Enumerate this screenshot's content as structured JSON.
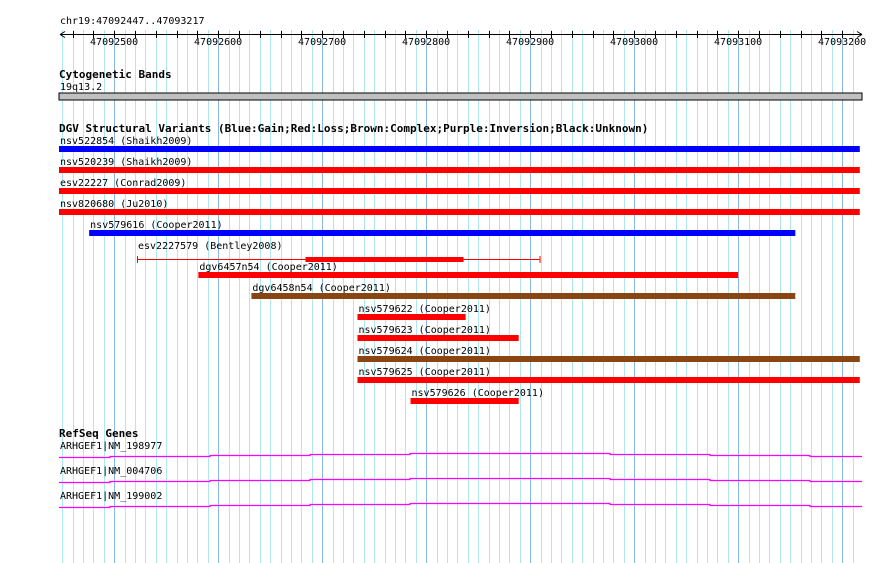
{
  "view": {
    "chrom": "chr19",
    "start": 47092447,
    "end": 47093217,
    "region_label": "chr19:47092447..47093217"
  },
  "ruler": {
    "tick_labels": [
      "47092500",
      "47092600",
      "47092700",
      "47092800",
      "47092900",
      "47093000",
      "47093100",
      "47093200"
    ]
  },
  "cyto": {
    "title": "Cytogenetic Bands",
    "band": "19q13.2",
    "color": "#c0c0c0"
  },
  "dgv": {
    "title": "DGV Structural Variants (Blue:Gain;Red:Loss;Brown:Complex;Purple:Inversion;Black:Unknown)",
    "colors": {
      "gain": "#0000ff",
      "loss": "#ff0000",
      "complex": "#8b4513"
    },
    "variants": [
      {
        "label": "nsv522854 (Shaikh2009)",
        "type": "gain",
        "start": 47092447,
        "end": 47093217
      },
      {
        "label": "nsv520239 (Shaikh2009)",
        "type": "loss",
        "start": 47092447,
        "end": 47093217
      },
      {
        "label": "esv22227 (Conrad2009)",
        "type": "loss",
        "start": 47092447,
        "end": 47093217
      },
      {
        "label": "nsv820680 (Ju2010)",
        "type": "loss",
        "start": 47092447,
        "end": 47093217
      },
      {
        "label": "nsv579616 (Cooper2011)",
        "type": "gain",
        "start": 47092476,
        "end": 47093155
      },
      {
        "label": "esv2227579 (Bentley2008)",
        "type": "loss",
        "start": 47092522,
        "end": 47092910,
        "inner_start": 47092684,
        "inner_end": 47092836
      },
      {
        "label": "dgv6457n54 (Cooper2011)",
        "type": "loss",
        "start": 47092581,
        "end": 47093100
      },
      {
        "label": "dgv6458n54 (Cooper2011)",
        "type": "complex",
        "start": 47092632,
        "end": 47093155
      },
      {
        "label": "nsv579622 (Cooper2011)",
        "type": "loss",
        "start": 47092734,
        "end": 47092838
      },
      {
        "label": "nsv579623 (Cooper2011)",
        "type": "loss",
        "start": 47092734,
        "end": 47092889
      },
      {
        "label": "nsv579624 (Cooper2011)",
        "type": "complex",
        "start": 47092734,
        "end": 47093217
      },
      {
        "label": "nsv579625 (Cooper2011)",
        "type": "loss",
        "start": 47092734,
        "end": 47093217
      },
      {
        "label": "nsv579626 (Cooper2011)",
        "type": "loss",
        "start": 47092785,
        "end": 47092889
      }
    ]
  },
  "refseq": {
    "title": "RefSeq Genes",
    "color": "#ff00ff",
    "genes": [
      {
        "label": "ARHGEF1|NM_198977"
      },
      {
        "label": "ARHGEF1|NM_004706"
      },
      {
        "label": "ARHGEF1|NM_199002"
      }
    ]
  }
}
